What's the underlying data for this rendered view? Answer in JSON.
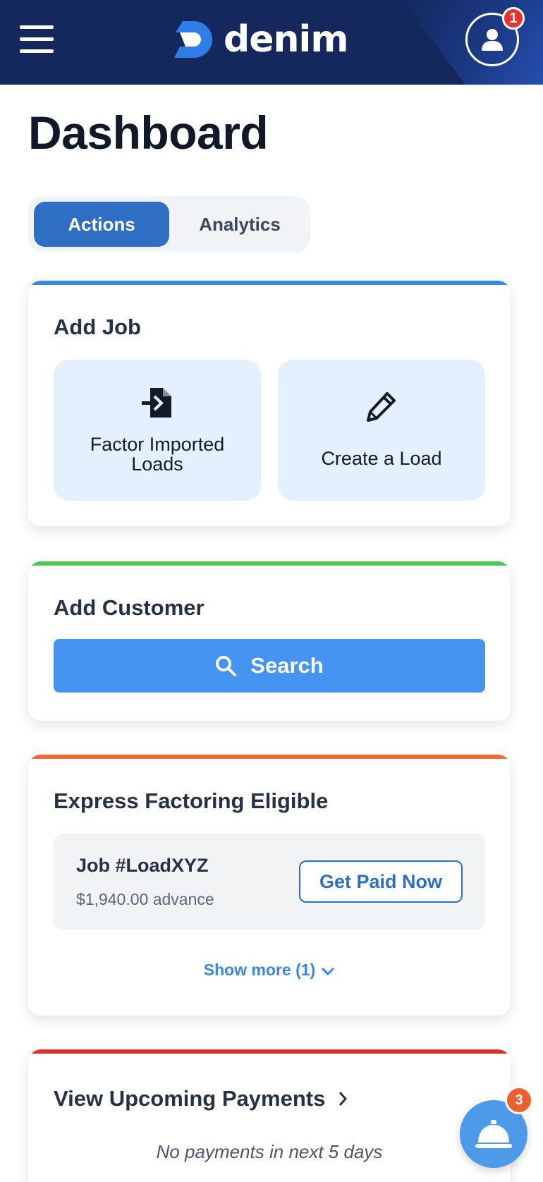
{
  "header": {
    "brand": "denim",
    "menu_icon": "hamburger-menu-icon",
    "profile_icon": "user-icon",
    "profile_badge_count": "1",
    "colors": {
      "background": "#14285e",
      "logo_accent": "#2f7de6",
      "badge": "#e8322e"
    }
  },
  "page": {
    "title": "Dashboard"
  },
  "tabs": [
    {
      "label": "Actions",
      "active": true
    },
    {
      "label": "Analytics",
      "active": false
    }
  ],
  "add_job": {
    "title": "Add Job",
    "accent": "#3a86e0",
    "tiles": [
      {
        "label_line1": "Factor Imported",
        "label_line2": "Loads",
        "icon": "file-import-icon"
      },
      {
        "label": "Create a Load",
        "icon": "pencil-icon"
      }
    ]
  },
  "add_customer": {
    "title": "Add Customer",
    "accent": "#4cc85a",
    "search_label": "Search",
    "search_icon": "search-icon"
  },
  "express_factoring": {
    "title": "Express Factoring Eligible",
    "accent": "#ec6a36",
    "job": {
      "name": "Job #LoadXYZ",
      "advance": "$1,940.00 advance",
      "button_label": "Get Paid Now"
    },
    "show_more_label": "Show more (1)"
  },
  "upcoming_payments": {
    "title": "View Upcoming Payments",
    "accent": "#d9342b",
    "empty_message": "No payments in next 5 days"
  },
  "notifications": {
    "icon": "service-bell-icon",
    "badge_count": "3",
    "badge_color": "#ec5f2f"
  }
}
